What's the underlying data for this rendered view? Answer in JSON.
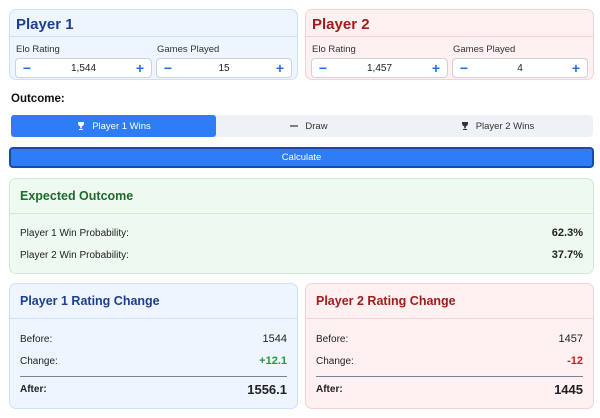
{
  "player1": {
    "title": "Player 1",
    "elo_label": "Elo Rating",
    "elo_value": "1,544",
    "games_label": "Games Played",
    "games_value": "15"
  },
  "player2": {
    "title": "Player 2",
    "elo_label": "Elo Rating",
    "elo_value": "1,457",
    "games_label": "Games Played",
    "games_value": "4"
  },
  "stepper_icons": {
    "decrement": "minus-icon",
    "increment": "plus-icon"
  },
  "outcome": {
    "label": "Outcome:",
    "options": [
      {
        "label": "Player 1 Wins",
        "icon": "trophy-icon",
        "selected": true
      },
      {
        "label": "Draw",
        "icon": "minus-icon",
        "selected": false
      },
      {
        "label": "Player 2 Wins",
        "icon": "trophy-icon",
        "selected": false
      }
    ]
  },
  "calculate_label": "Calculate",
  "expected": {
    "title": "Expected Outcome",
    "p1_label": "Player 1 Win Probability:",
    "p1_value": "62.3%",
    "p2_label": "Player 2 Win Probability:",
    "p2_value": "37.7%"
  },
  "p1_change": {
    "title": "Player 1 Rating Change",
    "before_label": "Before:",
    "before_value": "1544",
    "change_label": "Change:",
    "change_value": "+12.1",
    "after_label": "After:",
    "after_value": "1556.1"
  },
  "p2_change": {
    "title": "Player 2 Rating Change",
    "before_label": "Before:",
    "before_value": "1457",
    "change_label": "Change:",
    "change_value": "-12",
    "after_label": "After:",
    "after_value": "1445"
  },
  "colors": {
    "accent": "#2e7cf6",
    "player1": "#1d3f8f",
    "player2": "#a11c1c",
    "expected": "#1c6b2a",
    "positive": "#1e9c3c",
    "negative": "#d11a1a"
  }
}
